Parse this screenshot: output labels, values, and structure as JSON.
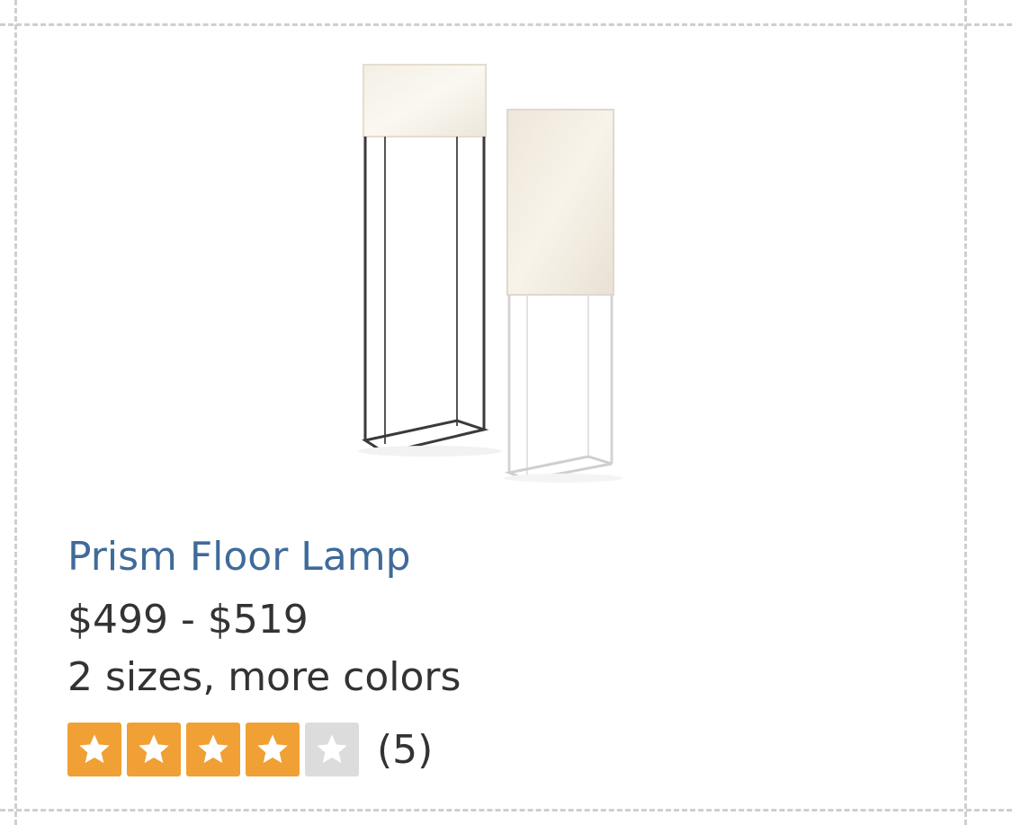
{
  "product": {
    "name": "Prism Floor Lamp",
    "price_range": "$499 - $519",
    "variants_text": "2 sizes, more colors",
    "rating": {
      "value": 4,
      "max": 5,
      "count_text": "(5)"
    },
    "image_icon": "floor-lamp-pair-image"
  },
  "colors": {
    "title_link": "#3f6b9a",
    "text": "#333333",
    "star_filled": "#f0a034",
    "star_empty": "#dcdcdc",
    "dashed_border": "#cfcfcf"
  }
}
